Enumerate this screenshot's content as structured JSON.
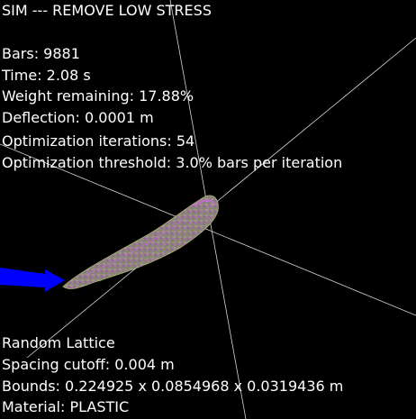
{
  "window": {
    "title": "SIM --- REMOVE LOW STRESS"
  },
  "stats": {
    "bars": "Bars: 9881",
    "time": "Time: 2.08 s",
    "weight_remaining": "Weight remaining: 17.88%",
    "deflection": "Deflection: 0.0001 m",
    "optimization_iterations": "Optimization iterations: 54",
    "optimization_threshold": "Optimization threshold: 3.0% bars per iteration"
  },
  "lattice": {
    "type": "Random Lattice",
    "spacing_cutoff": "Spacing cutoff: 0.004 m",
    "bounds": "Bounds: 0.224925 x 0.0854968 x 0.0319436 m",
    "material": "Material: PLASTIC"
  },
  "colors": {
    "background": "#000000",
    "text": "#ffffff",
    "axis_lines": "#d8d8d8",
    "load_arrow": "#0000ff",
    "structure_green": "#8fa85f",
    "structure_magenta": "#b05ab8"
  }
}
